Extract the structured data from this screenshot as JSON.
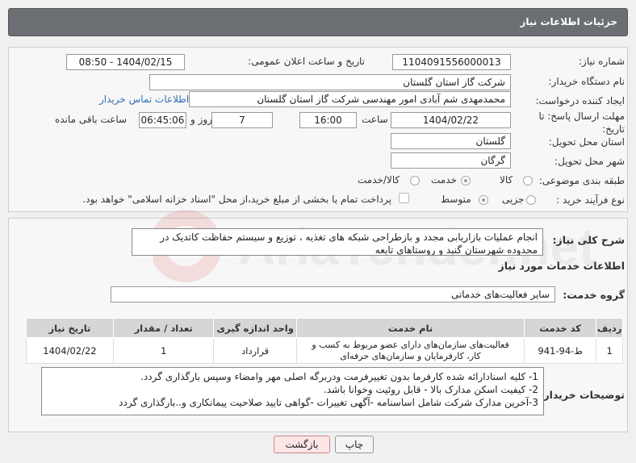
{
  "header": {
    "title": "جزئیات اطلاعات نیاز"
  },
  "fields": {
    "need_number_label": "شماره نیاز:",
    "need_number": "1104091556000013",
    "announce_datetime_label": "تاریخ و ساعت اعلان عمومی:",
    "announce_datetime": "1404/02/15 - 08:50",
    "buyer_org_label": "نام دستگاه خریدار:",
    "buyer_org": "شرکت گاز استان گلستان",
    "requester_label": "ایجاد کننده درخواست:",
    "requester": "محمدمهدی شم آبادی امور مهندسی شرکت گاز استان گلستان",
    "buyer_contact_link": "اطلاعات تماس خریدار",
    "deadline_label": "مهلت ارسال پاسخ: تا تاریخ:",
    "deadline_date": "1404/02/22",
    "time_label": "ساعت",
    "deadline_time": "16:00",
    "days_value": "7",
    "days_label": "روز و",
    "remaining_time": "06:45:06",
    "remaining_label": "ساعت باقی مانده",
    "province_label": "استان محل تحویل:",
    "province": "گلستان",
    "city_label": "شهر محل تحویل:",
    "city": "گرگان",
    "category_label": "طبقه بندی موضوعی:",
    "category_options": [
      "کالا",
      "خدمت",
      "کالا/خدمت"
    ],
    "category_selected": "خدمت",
    "purchase_type_label": "نوع فرآیند خرید :",
    "purchase_type_options": [
      "جزیی",
      "متوسط"
    ],
    "purchase_type_selected": "متوسط",
    "treasury_note": "پرداخت تمام یا بخشی از مبلغ خرید،از محل \"اسناد خزانه اسلامی\" خواهد بود."
  },
  "summary": {
    "label": "شرح کلی نیاز:",
    "text": "انجام عملیات بازاریابی مجدد و بازطراحی شبکه های تغذیه ، توزیع و  سیستم حفاظت کاتدیک در محدوده شهرستان گنبد و روستاهای تابعه"
  },
  "services_section": {
    "title": "اطلاعات خدمات مورد نیاز",
    "group_label": "گروه خدمت:",
    "group_value": "سایر فعالیت‌های خدماتی",
    "columns": [
      "ردیف",
      "کد خدمت",
      "نام خدمت",
      "واحد اندازه گیری",
      "تعداد / مقدار",
      "تاریخ نیاز"
    ],
    "rows": [
      {
        "row": "1",
        "code": "ط-94-941",
        "name": "فعالیت‌های سازمان‌های دارای عضو مربوط به کسب و کار، کارفرمایان و سازمان‌های حرفه‌ای",
        "unit": "قرارداد",
        "qty": "1",
        "date": "1404/02/22"
      }
    ]
  },
  "buyer_notes": {
    "label": "توضیحات خریدار:",
    "lines": [
      "1-    کلیه اسنادارائه شده کارفرما بدون تغییرفرمت ودربرگه اصلی مهر وامضاء وسپس بارگذاری گردد.",
      "2-    کیفیت اسکن مدارک بالا - قابل روئیت وخوانا باشد.",
      "3-آخرین مدارک شرکت شامل اساسنامه -آگهی تغییرات -گواهی تایید صلاحیت پیمانکاری و..بارگذاری گردد"
    ]
  },
  "buttons": {
    "print": "چاپ",
    "back": "بازگشت"
  },
  "watermark": {
    "text": "AriaTender.net"
  },
  "colors": {
    "title_bar": "#6b6e73",
    "link": "#2f6fb6",
    "back_button": "#fde6e6"
  }
}
